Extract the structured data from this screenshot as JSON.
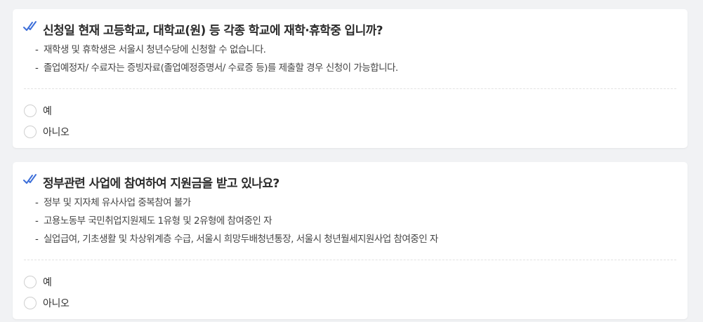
{
  "questions": [
    {
      "title": "신청일 현재 고등학교, 대학교(원) 등 각종 학교에 재학·휴학중 입니까?",
      "notes": [
        "재학생 및 휴학생은 서울시 청년수당에 신청할 수 없습니다.",
        "졸업예정자/ 수료자는 증빙자료(졸업예정증명서/ 수료증 등)를 제출할 경우 신청이 가능합니다."
      ],
      "options": [
        "예",
        "아니오"
      ]
    },
    {
      "title": "정부관련 사업에 참여하여 지원금을 받고 있나요?",
      "notes": [
        "정부 및 지자체 유사사업 중복참여 불가",
        "고용노동부 국민취업지원제도 1유형 및 2유형에 참여중인 자",
        "실업급여, 기초생활 및 차상위계층 수급, 서울시 희망두배청년통장, 서울시 청년월세지원사업 참여중인 자"
      ],
      "options": [
        "예",
        "아니오"
      ]
    }
  ],
  "dash": "-",
  "colors": {
    "background": "#f1f2f4",
    "card": "#ffffff",
    "check_accent": "#3d6fd9"
  },
  "icons": {
    "question_marker": "double-check-icon",
    "option_control": "radio-button"
  }
}
